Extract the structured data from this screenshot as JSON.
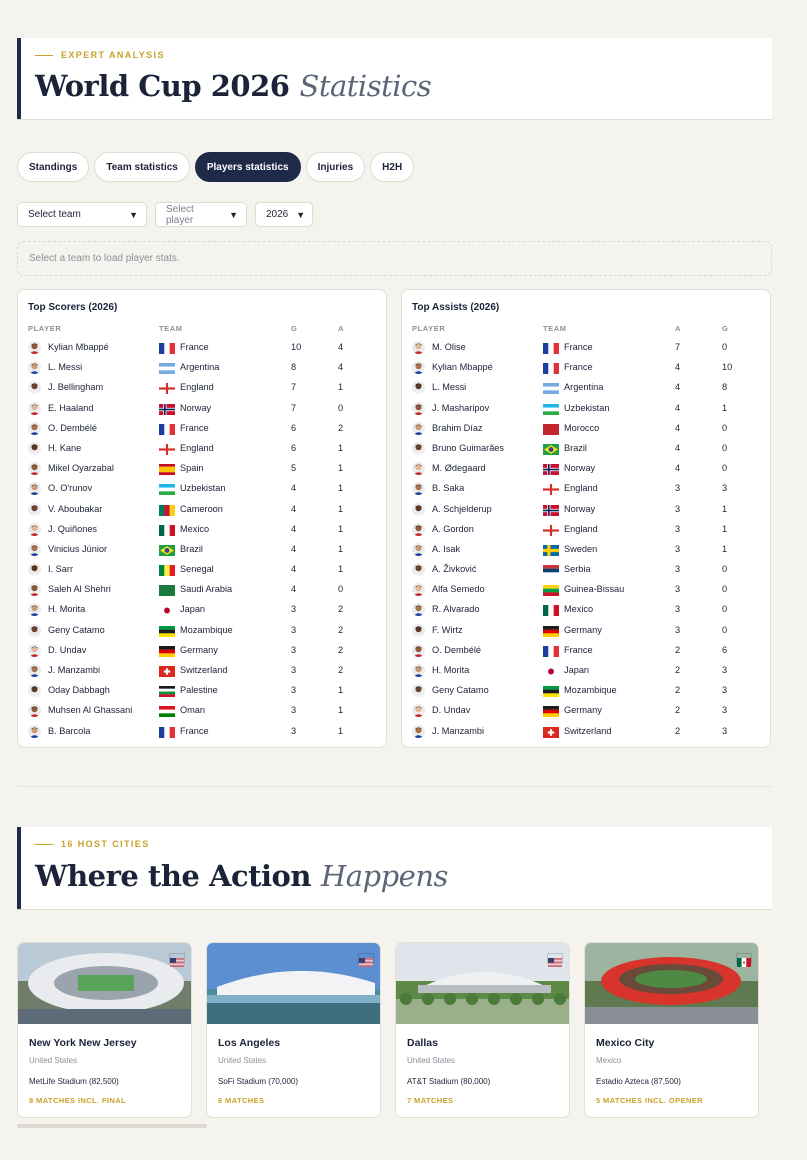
{
  "stats_header": {
    "eyebrow": "EXPERT ANALYSIS",
    "title_main": "World Cup 2026",
    "title_accent": "Statistics"
  },
  "tabs": [
    {
      "label": "Standings",
      "active": false
    },
    {
      "label": "Team statistics",
      "active": false
    },
    {
      "label": "Players statistics",
      "active": true
    },
    {
      "label": "Injuries",
      "active": false
    },
    {
      "label": "H2H",
      "active": false
    }
  ],
  "filters": {
    "team": "Select team",
    "player": "Select player",
    "year": "2026"
  },
  "notice": "Select a team to load player stats.",
  "flags": {
    "France": [
      "v",
      "#1f3fa0",
      "#ffffff",
      "#e0303b"
    ],
    "Argentina": [
      "h",
      "#74acdf",
      "#ffffff",
      "#74acdf"
    ],
    "England": [
      "cross",
      "#ffffff",
      "#d32f2f"
    ],
    "Norway": [
      "nordic",
      "#c8102e",
      "#ffffff",
      "#00205b"
    ],
    "Spain": [
      "h3",
      "#c60b1e",
      "#ffc400",
      "#c60b1e"
    ],
    "Uzbekistan": [
      "h",
      "#1eb4e6",
      "#ffffff",
      "#2eab3e"
    ],
    "Cameroon": [
      "v",
      "#007a5e",
      "#ce1126",
      "#fcd116"
    ],
    "Mexico": [
      "v",
      "#006847",
      "#ffffff",
      "#ce1126"
    ],
    "Brazil": [
      "diamond",
      "#229e45",
      "#f8e509",
      "#2b49a3"
    ],
    "Senegal": [
      "v",
      "#00853f",
      "#fdef42",
      "#e31b23"
    ],
    "Saudi Arabia": [
      "solid",
      "#1b7a3e"
    ],
    "Japan": [
      "disc",
      "#ffffff",
      "#bc002d"
    ],
    "Mozambique": [
      "h",
      "#009a44",
      "#1c1c1c",
      "#fce100"
    ],
    "Germany": [
      "h",
      "#1c1c1c",
      "#dd0000",
      "#ffce00"
    ],
    "Switzerland": [
      "swiss",
      "#da291c",
      "#ffffff"
    ],
    "Palestine": [
      "h",
      "#1c1c1c",
      "#ffffff",
      "#009736",
      "#ce1126"
    ],
    "Oman": [
      "h",
      "#db161b",
      "#ffffff",
      "#008000"
    ],
    "Morocco": [
      "solid",
      "#c1272d"
    ],
    "Sweden": [
      "nordic",
      "#006aa7",
      "#fecc00"
    ],
    "Serbia": [
      "h",
      "#c6363c",
      "#0c4076",
      "#ffffff"
    ],
    "Guinea-Bissau": [
      "h",
      "#fcd116",
      "#009e49",
      "#ce1126"
    ]
  },
  "top_scorers": {
    "title": "Top Scorers (2026)",
    "columns": {
      "player": "PLAYER",
      "team": "TEAM",
      "v1": "G",
      "v2": "A"
    },
    "rows": [
      {
        "player": "Kylian Mbappé",
        "team": "France",
        "v1": "10",
        "v2": "4"
      },
      {
        "player": "L. Messi",
        "team": "Argentina",
        "v1": "8",
        "v2": "4"
      },
      {
        "player": "J. Bellingham",
        "team": "England",
        "v1": "7",
        "v2": "1"
      },
      {
        "player": "E. Haaland",
        "team": "Norway",
        "v1": "7",
        "v2": "0"
      },
      {
        "player": "O. Dembélé",
        "team": "France",
        "v1": "6",
        "v2": "2"
      },
      {
        "player": "H. Kane",
        "team": "England",
        "v1": "6",
        "v2": "1"
      },
      {
        "player": "Mikel Oyarzabal",
        "team": "Spain",
        "v1": "5",
        "v2": "1"
      },
      {
        "player": "O. O'runov",
        "team": "Uzbekistan",
        "v1": "4",
        "v2": "1"
      },
      {
        "player": "V. Aboubakar",
        "team": "Cameroon",
        "v1": "4",
        "v2": "1"
      },
      {
        "player": "J. Quiñones",
        "team": "Mexico",
        "v1": "4",
        "v2": "1"
      },
      {
        "player": "Vinicius Júnior",
        "team": "Brazil",
        "v1": "4",
        "v2": "1"
      },
      {
        "player": "I. Sarr",
        "team": "Senegal",
        "v1": "4",
        "v2": "1"
      },
      {
        "player": "Saleh Al Shehri",
        "team": "Saudi Arabia",
        "v1": "4",
        "v2": "0"
      },
      {
        "player": "H. Morita",
        "team": "Japan",
        "v1": "3",
        "v2": "2"
      },
      {
        "player": "Geny Catamo",
        "team": "Mozambique",
        "v1": "3",
        "v2": "2"
      },
      {
        "player": "D. Undav",
        "team": "Germany",
        "v1": "3",
        "v2": "2"
      },
      {
        "player": "J. Manzambi",
        "team": "Switzerland",
        "v1": "3",
        "v2": "2"
      },
      {
        "player": "Oday Dabbagh",
        "team": "Palestine",
        "v1": "3",
        "v2": "1"
      },
      {
        "player": "Muhsen Al Ghassani",
        "team": "Oman",
        "v1": "3",
        "v2": "1"
      },
      {
        "player": "B. Barcola",
        "team": "France",
        "v1": "3",
        "v2": "1"
      }
    ]
  },
  "top_assists": {
    "title": "Top Assists (2026)",
    "columns": {
      "player": "PLAYER",
      "team": "TEAM",
      "v1": "A",
      "v2": "G"
    },
    "rows": [
      {
        "player": "M. Olise",
        "team": "France",
        "v1": "7",
        "v2": "0"
      },
      {
        "player": "Kylian Mbappé",
        "team": "France",
        "v1": "4",
        "v2": "10"
      },
      {
        "player": "L. Messi",
        "team": "Argentina",
        "v1": "4",
        "v2": "8"
      },
      {
        "player": "J. Masharipov",
        "team": "Uzbekistan",
        "v1": "4",
        "v2": "1"
      },
      {
        "player": "Brahim Díaz",
        "team": "Morocco",
        "v1": "4",
        "v2": "0"
      },
      {
        "player": "Bruno Guimarães",
        "team": "Brazil",
        "v1": "4",
        "v2": "0"
      },
      {
        "player": "M. Ødegaard",
        "team": "Norway",
        "v1": "4",
        "v2": "0"
      },
      {
        "player": "B. Saka",
        "team": "England",
        "v1": "3",
        "v2": "3"
      },
      {
        "player": "A. Schjelderup",
        "team": "Norway",
        "v1": "3",
        "v2": "1"
      },
      {
        "player": "A. Gordon",
        "team": "England",
        "v1": "3",
        "v2": "1"
      },
      {
        "player": "A. Isak",
        "team": "Sweden",
        "v1": "3",
        "v2": "1"
      },
      {
        "player": "A. Živković",
        "team": "Serbia",
        "v1": "3",
        "v2": "0"
      },
      {
        "player": "Alfa Semedo",
        "team": "Guinea-Bissau",
        "v1": "3",
        "v2": "0"
      },
      {
        "player": "R. Alvarado",
        "team": "Mexico",
        "v1": "3",
        "v2": "0"
      },
      {
        "player": "F. Wirtz",
        "team": "Germany",
        "v1": "3",
        "v2": "0"
      },
      {
        "player": "O. Dembélé",
        "team": "France",
        "v1": "2",
        "v2": "6"
      },
      {
        "player": "H. Morita",
        "team": "Japan",
        "v1": "2",
        "v2": "3"
      },
      {
        "player": "Geny Catamo",
        "team": "Mozambique",
        "v1": "2",
        "v2": "3"
      },
      {
        "player": "D. Undav",
        "team": "Germany",
        "v1": "2",
        "v2": "3"
      },
      {
        "player": "J. Manzambi",
        "team": "Switzerland",
        "v1": "2",
        "v2": "3"
      }
    ]
  },
  "cities_header": {
    "eyebrow": "16 HOST CITIES",
    "title_main": "Where the Action",
    "title_accent": "Happens"
  },
  "cities": [
    {
      "name": "New York New Jersey",
      "country": "United States",
      "stadium": "MetLife Stadium (82,500)",
      "matches": "8 MATCHES INCL. FINAL",
      "flag": "usa",
      "sky": "#b9c9d6",
      "ground": "#6f7d6a",
      "roof": "#e9ebee",
      "accent": "#5aa35a"
    },
    {
      "name": "Los Angeles",
      "country": "United States",
      "stadium": "SoFi Stadium (70,000)",
      "matches": "6 MATCHES",
      "flag": "usa",
      "sky": "#5b8fd1",
      "ground": "#4f8a9a",
      "roof": "#f2f3f5",
      "accent": "#7fb0c8"
    },
    {
      "name": "Dallas",
      "country": "United States",
      "stadium": "AT&T Stadium (80,000)",
      "matches": "7 MATCHES",
      "flag": "usa",
      "sky": "#dfe5ea",
      "ground": "#5e8a48",
      "roof": "#eef0f2",
      "accent": "#9ab08a"
    },
    {
      "name": "Mexico City",
      "country": "Mexico",
      "stadium": "Estadio Azteca (87,500)",
      "matches": "5 MATCHES INCL. OPENER",
      "flag": "mexico",
      "sky": "#9db4a0",
      "ground": "#5f7a4f",
      "roof": "#d9342b",
      "accent": "#8a8f96"
    }
  ]
}
